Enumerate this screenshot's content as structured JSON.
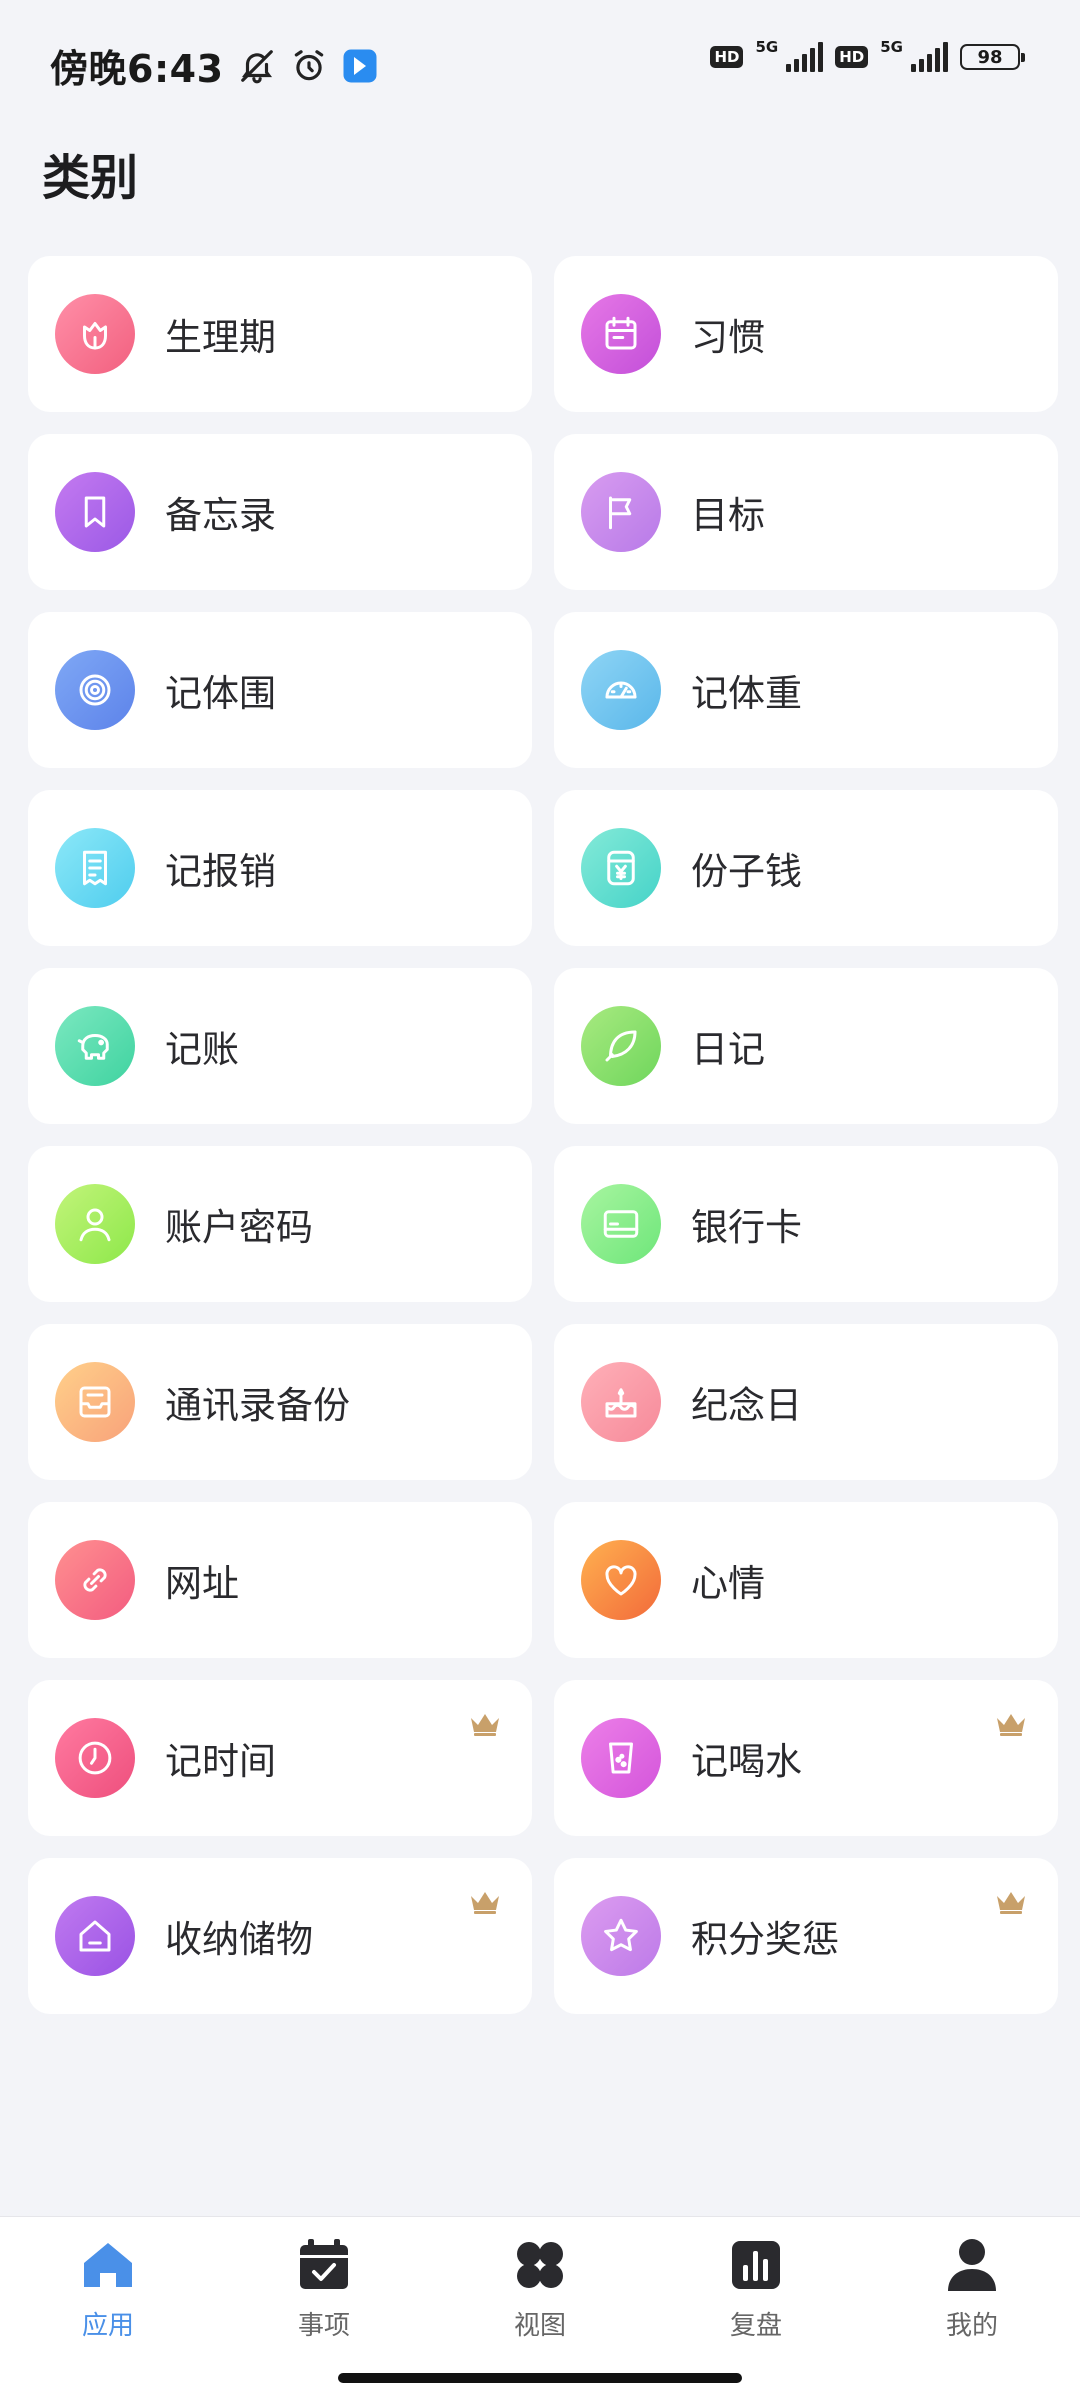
{
  "status_bar": {
    "time": "傍晚6:43",
    "hd1": "HD",
    "net1": "5G",
    "hd2": "HD",
    "net2": "5G",
    "battery": "98"
  },
  "page_title": "类别",
  "categories": [
    {
      "label": "生理期",
      "icon": "flower-icon",
      "color1": "#ff8fa8",
      "color2": "#f2607f",
      "crown": false
    },
    {
      "label": "习惯",
      "icon": "calendar-icon",
      "color1": "#e678e6",
      "color2": "#c34fd9",
      "crown": false
    },
    {
      "label": "备忘录",
      "icon": "bookmark-icon",
      "color1": "#c47af0",
      "color2": "#9b59e6",
      "crown": false
    },
    {
      "label": "目标",
      "icon": "flag-icon",
      "color1": "#d89cf0",
      "color2": "#b87ae8",
      "crown": false
    },
    {
      "label": "记体围",
      "icon": "ripple-icon",
      "color1": "#7fa8f5",
      "color2": "#5d83ea",
      "crown": false
    },
    {
      "label": "记体重",
      "icon": "gauge-icon",
      "color1": "#8fd5f5",
      "color2": "#5ab7ea",
      "crown": false
    },
    {
      "label": "记报销",
      "icon": "receipt-icon",
      "color1": "#8ce8f8",
      "color2": "#4fcdee",
      "crown": false
    },
    {
      "label": "份子钱",
      "icon": "gift-money-icon",
      "color1": "#84ead8",
      "color2": "#45d3c8",
      "crown": false
    },
    {
      "label": "记账",
      "icon": "piggy-bank-icon",
      "color1": "#7be8c0",
      "color2": "#3fd3a0",
      "crown": false
    },
    {
      "label": "日记",
      "icon": "feather-icon",
      "color1": "#a8ea80",
      "color2": "#6fd65c",
      "crown": false
    },
    {
      "label": "账户密码",
      "icon": "user-icon",
      "color1": "#c2f47a",
      "color2": "#8ee84a",
      "crown": false
    },
    {
      "label": "银行卡",
      "icon": "card-icon",
      "color1": "#a8f5a0",
      "color2": "#6ee67a",
      "crown": false
    },
    {
      "label": "通讯录备份",
      "icon": "inbox-icon",
      "color1": "#ffd08a",
      "color2": "#f8a27a",
      "crown": false
    },
    {
      "label": "纪念日",
      "icon": "cake-icon",
      "color1": "#ffb0b8",
      "color2": "#f68a9a",
      "crown": false
    },
    {
      "label": "网址",
      "icon": "link-icon",
      "color1": "#ff9090",
      "color2": "#f35c80",
      "crown": false
    },
    {
      "label": "心情",
      "icon": "heart-icon",
      "color1": "#ffb150",
      "color2": "#f26a3a",
      "crown": false
    },
    {
      "label": "记时间",
      "icon": "clock-icon",
      "color1": "#ff7aa0",
      "color2": "#ee4f7d",
      "crown": true
    },
    {
      "label": "记喝水",
      "icon": "cup-icon",
      "color1": "#ec7fe8",
      "color2": "#d455db",
      "crown": true
    },
    {
      "label": "收纳储物",
      "icon": "house-icon",
      "color1": "#c07af0",
      "color2": "#9a52e4",
      "crown": true
    },
    {
      "label": "积分奖惩",
      "icon": "star-icon",
      "color1": "#dc9cf0",
      "color2": "#bd7ae8",
      "crown": true
    }
  ],
  "bottom_nav": [
    {
      "label": "应用",
      "icon": "home-icon",
      "active": true
    },
    {
      "label": "事项",
      "icon": "calendar-check-icon",
      "active": false
    },
    {
      "label": "视图",
      "icon": "grid-view-icon",
      "active": false
    },
    {
      "label": "复盘",
      "icon": "bar-chart-icon",
      "active": false
    },
    {
      "label": "我的",
      "icon": "profile-icon",
      "active": false
    }
  ],
  "colors": {
    "accent": "#4a90e8",
    "crown": "#c8a06a",
    "background": "#f3f4f8"
  }
}
